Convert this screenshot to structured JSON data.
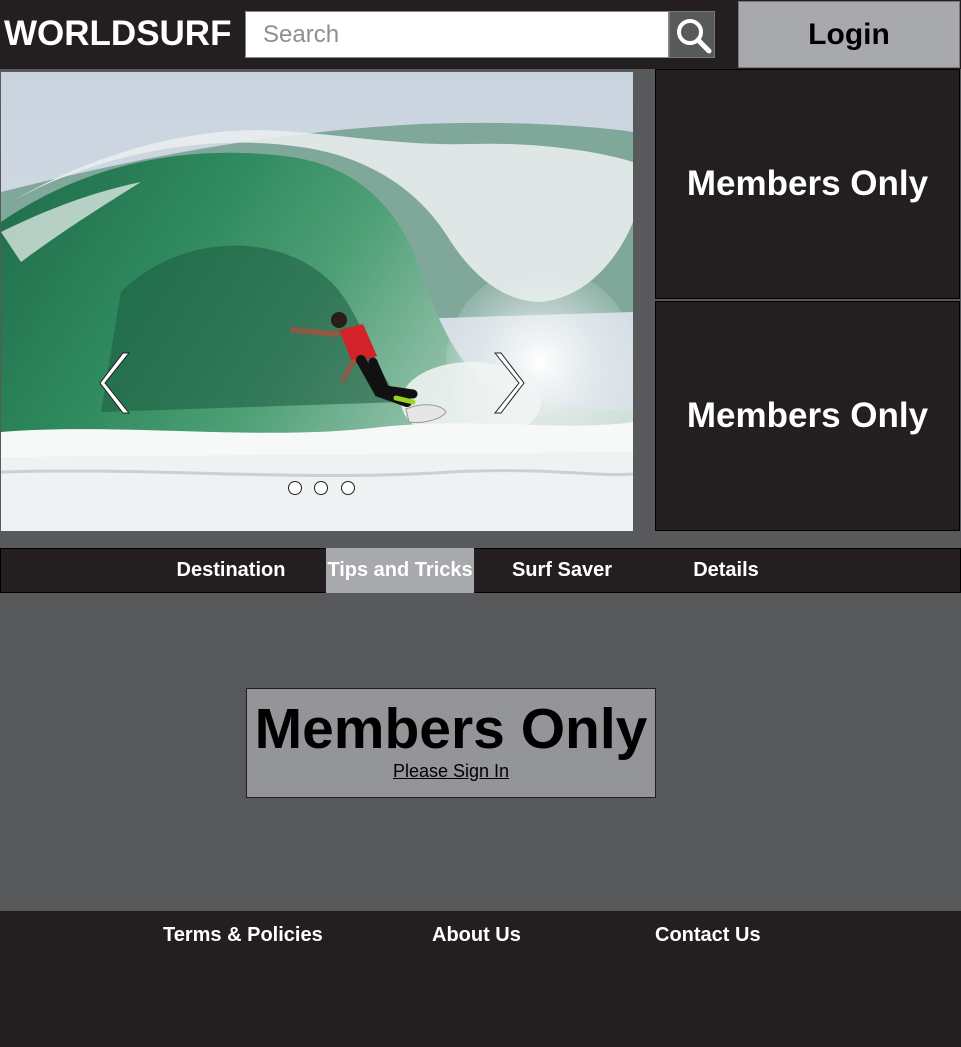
{
  "header": {
    "logo": "WORLDSURF",
    "search_placeholder": "Search",
    "search_icon": "search-icon",
    "login_label": "Login"
  },
  "carousel": {
    "image": "surfer riding inside a breaking green wave",
    "prev_icon": "chevron-left-icon",
    "next_icon": "chevron-right-icon",
    "slide_count": 3
  },
  "side_panels": [
    {
      "label": "Members Only"
    },
    {
      "label": "Members Only"
    }
  ],
  "nav": {
    "items": [
      {
        "label": "Destination"
      },
      {
        "label": "Tips and Tricks",
        "active": true
      },
      {
        "label": "Surf Saver"
      },
      {
        "label": "Details"
      }
    ]
  },
  "main": {
    "title": "Members Only",
    "sign_in_label": "Please Sign In"
  },
  "footer": {
    "links": [
      {
        "label": "Terms & Policies"
      },
      {
        "label": "About Us"
      },
      {
        "label": "Contact Us"
      }
    ]
  },
  "colors": {
    "dark": "#231f20",
    "mid_gray": "#58595b",
    "light_gray": "#a7a9ac",
    "box_gray": "#939598"
  }
}
